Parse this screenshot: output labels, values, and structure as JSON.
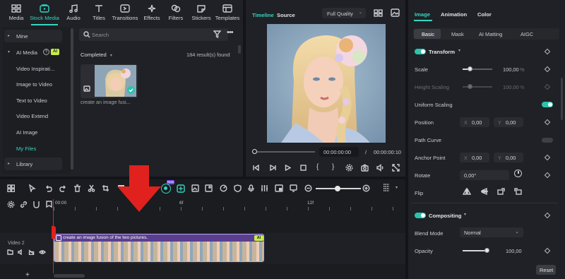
{
  "toolbar": {
    "items": [
      {
        "label": "Media",
        "icon": "media-icon"
      },
      {
        "label": "Stock Media",
        "icon": "stock-media-icon",
        "active": true
      },
      {
        "label": "Audio",
        "icon": "audio-icon"
      },
      {
        "label": "Titles",
        "icon": "titles-icon"
      },
      {
        "label": "Transitions",
        "icon": "transitions-icon"
      },
      {
        "label": "Effects",
        "icon": "effects-icon"
      },
      {
        "label": "Filters",
        "icon": "filters-icon"
      },
      {
        "label": "Stickers",
        "icon": "stickers-icon"
      },
      {
        "label": "Templates",
        "icon": "templates-icon"
      }
    ]
  },
  "sidebar": {
    "mine": "Mine",
    "ai_media": "AI Media",
    "ai_badge": "AI",
    "items": [
      "Video Inspirati...",
      "Image to Video",
      "Text to Video",
      "Video Extend",
      "AI Image",
      "My Files"
    ],
    "library": "Library"
  },
  "media": {
    "search_placeholder": "Search",
    "filter_label": "Completed",
    "result_count": "184 result(s) found",
    "thumb_caption": "create an image fusi..."
  },
  "preview": {
    "tab_timeline": "Timeline",
    "tab_source": "Source",
    "quality": "Full Quality",
    "current_time": "00:00:00:00",
    "separator": "/",
    "total_time": "00:00:00:10"
  },
  "inspector": {
    "tabs": [
      "Image",
      "Animation",
      "Color"
    ],
    "subtabs": [
      "Basic",
      "Mask",
      "AI Matting",
      "AIGC"
    ],
    "transform_title": "Transform",
    "scale_label": "Scale",
    "scale_value": "100,00",
    "scale_unit": "%",
    "height_label": "Height Scaling",
    "height_value": "100,00",
    "height_unit": "%",
    "uniform_label": "Uniform Scaling",
    "position_label": "Position",
    "pos_x_prefix": "X",
    "pos_x": "0,00",
    "pos_y_prefix": "Y",
    "pos_y": "0,00",
    "path_curve_label": "Path Curve",
    "anchor_label": "Anchor Point",
    "anchor_x_prefix": "X",
    "anchor_x": "0,00",
    "anchor_y_prefix": "Y",
    "anchor_y": "0,00",
    "rotate_label": "Rotate",
    "rotate_value": "0,00°",
    "flip_label": "Flip",
    "compositing_title": "Compositing",
    "blend_label": "Blend Mode",
    "blend_value": "Normal",
    "opacity_label": "Opacity",
    "opacity_value": "100,00",
    "reset_label": "Reset"
  },
  "timeline": {
    "ruler": [
      "00:00",
      "6f",
      "12f"
    ],
    "track_label": "Video 2",
    "clip_title": "create an image fusion of the two pictures.",
    "clip_badge": "AI",
    "new_badge": "New"
  },
  "colors": {
    "accent": "#35d6c0",
    "arrow": "#e0211d",
    "clip": "#5b3f8f"
  }
}
